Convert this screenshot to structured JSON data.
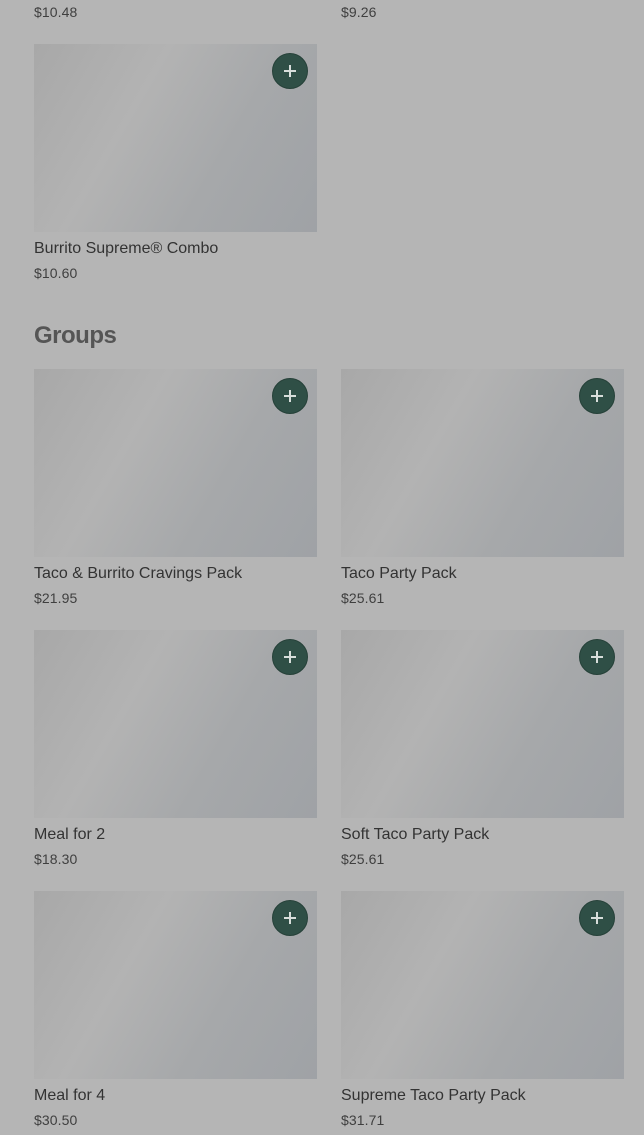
{
  "top_row": {
    "left_price": "$10.48",
    "right_price": "$9.26"
  },
  "entrees": [
    {
      "name": "Burrito Supreme® Combo",
      "price": "$10.60"
    }
  ],
  "groups": {
    "title": "Groups",
    "items": [
      {
        "name": "Taco & Burrito Cravings Pack",
        "price": "$21.95"
      },
      {
        "name": "Taco Party Pack",
        "price": "$25.61"
      },
      {
        "name": "Meal for 2",
        "price": "$18.30"
      },
      {
        "name": "Soft Taco Party Pack",
        "price": "$25.61"
      },
      {
        "name": "Meal for 4",
        "price": "$30.50"
      },
      {
        "name": "Supreme Taco Party Pack",
        "price": "$31.71"
      }
    ]
  },
  "icons": {
    "add": "plus-icon"
  },
  "colors": {
    "background": "#b5b5b5",
    "add_button": "#2f4f46",
    "image_placeholder": "#a9aaac"
  }
}
